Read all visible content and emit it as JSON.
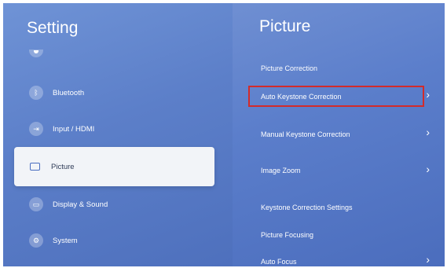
{
  "left_panel": {
    "title": "Setting",
    "items": [
      {
        "label": "Bluetooth",
        "icon": "bluetooth-icon"
      },
      {
        "label": "Input / HDMI",
        "icon": "input-icon"
      },
      {
        "label": "Picture",
        "icon": "picture-icon",
        "selected": true
      },
      {
        "label": "Display & Sound",
        "icon": "display-icon"
      },
      {
        "label": "System",
        "icon": "system-icon"
      }
    ]
  },
  "right_panel": {
    "title": "Picture",
    "items": [
      {
        "label": "Picture Correction"
      },
      {
        "label": "Auto Keystone Correction",
        "highlighted": true
      },
      {
        "label": "Manual Keystone Correction"
      },
      {
        "label": "Image Zoom"
      },
      {
        "label": "Keystone Correction Settings"
      },
      {
        "label": "Picture Focusing"
      },
      {
        "label": "Auto Focus"
      }
    ]
  },
  "colors": {
    "highlight_border": "#d22b2b",
    "selected_bg": "#f2f4f8"
  }
}
